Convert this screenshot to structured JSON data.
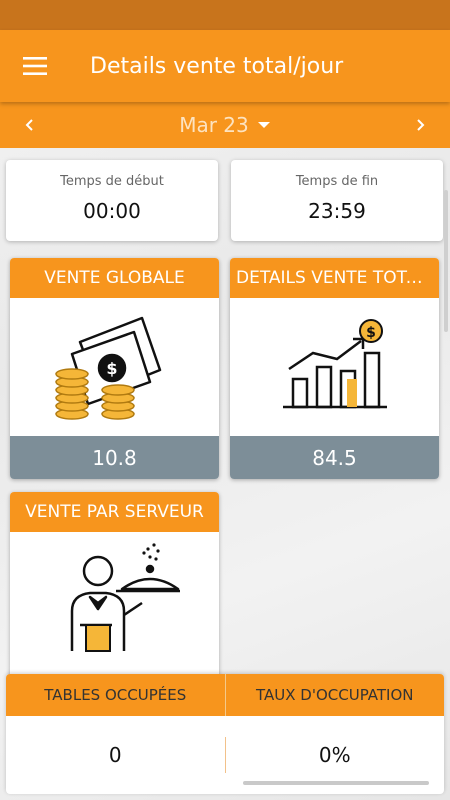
{
  "app": {
    "title": "Details vente total/jour"
  },
  "date_nav": {
    "selected_date": "Mar 23"
  },
  "time_range": {
    "start_label": "Temps de début",
    "start_value": "00:00",
    "end_label": "Temps de fin",
    "end_value": "23:59"
  },
  "cards": [
    {
      "title": "VENTE GLOBALE",
      "value": "10.8",
      "icon": "money-stack-icon"
    },
    {
      "title": "DETAILS VENTE TOTAL/JOUR",
      "value": "84.5",
      "icon": "growth-chart-icon"
    },
    {
      "title": "VENTE PAR SERVEUR",
      "value": "",
      "icon": "waiter-icon"
    }
  ],
  "stats": {
    "tables_label": "TABLES OCCUPÉES",
    "tables_value": "0",
    "rate_label": "TAUX D'OCCUPATION",
    "rate_value": "0%"
  },
  "colors": {
    "accent": "#f7951d",
    "status_bar": "#c8741c",
    "card_footer": "#7d8e98",
    "icon_gold": "#f5b638"
  }
}
